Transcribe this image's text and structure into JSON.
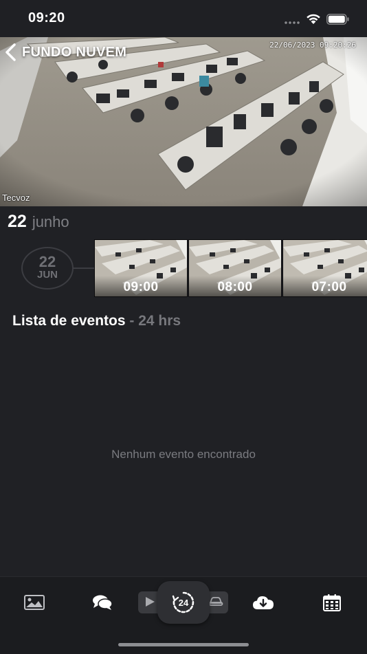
{
  "status_bar": {
    "time": "09:20"
  },
  "camera": {
    "title": "FUNDO NUVEM",
    "timestamp": "22/06/2023 09:20:26",
    "watermark": "Tecvoz"
  },
  "date_header": {
    "day": "22",
    "month": "junho"
  },
  "timeline": {
    "date_day": "22",
    "date_month": "JUN",
    "thumbnails": [
      {
        "time": "09:00"
      },
      {
        "time": "08:00"
      },
      {
        "time": "07:00"
      }
    ]
  },
  "events": {
    "title": "Lista de eventos",
    "subtitle": "- 24 hrs",
    "empty_message": "Nenhum evento encontrado"
  },
  "tabbar": {
    "items": [
      {
        "icon": "image-icon"
      },
      {
        "icon": "chat-icon"
      },
      {
        "icon": "play-icon"
      },
      {
        "icon": "24h-icon"
      },
      {
        "icon": "car-icon"
      },
      {
        "icon": "cloud-download-icon"
      },
      {
        "icon": "calendar-icon"
      }
    ]
  },
  "colors": {
    "background": "#202125",
    "muted_text": "#7f8085",
    "tabbar": "#1b1c1f"
  }
}
